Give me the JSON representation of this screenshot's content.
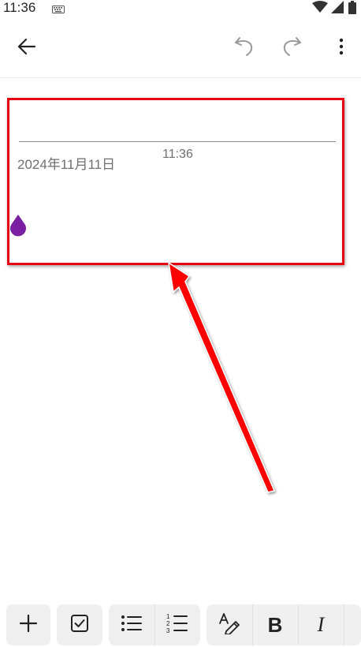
{
  "status_bar": {
    "time": "11:36",
    "icons": [
      "keyboard-icon",
      "wifi-icon",
      "signal-icon",
      "battery-icon"
    ]
  },
  "toolbar": {
    "buttons": [
      "back-arrow-icon",
      "undo-icon",
      "redo-icon",
      "more-vert-icon"
    ]
  },
  "note": {
    "date": "2024年11月11日",
    "time": "11:36",
    "cursor_handle_color": "#7b1fa2"
  },
  "annotation": {
    "box_color": "#e60012",
    "arrow_color": "#ff0000"
  },
  "format_bar": {
    "buttons": [
      "add-icon",
      "checkbox-icon",
      "bulleted-list-icon",
      "numbered-list-icon",
      "text-style-icon",
      "bold-icon",
      "italic-icon"
    ],
    "bold_label": "B",
    "italic_label": "I"
  }
}
